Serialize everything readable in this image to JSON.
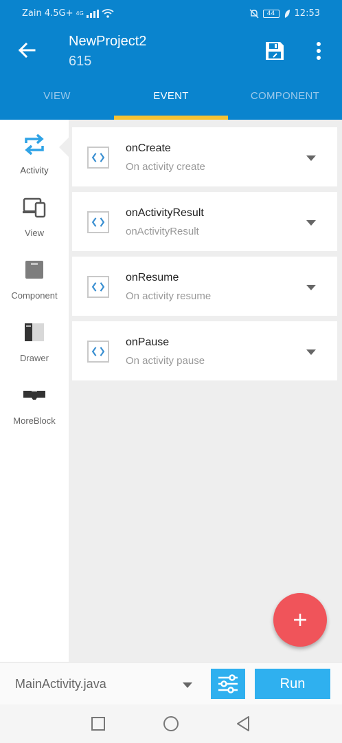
{
  "status_bar": {
    "carrier": "Zain 4.5G+",
    "network_badge": "4G",
    "battery": "44",
    "time": "12:53"
  },
  "app_bar": {
    "title": "NewProject2",
    "subtitle": "615",
    "back_icon": "arrow-back-icon",
    "save_icon": "save-icon",
    "more_icon": "more-vert-icon",
    "background_color": "#0a84ce",
    "indicator_color": "#f5c233"
  },
  "tabs": [
    {
      "label": "VIEW",
      "active": false
    },
    {
      "label": "EVENT",
      "active": true
    },
    {
      "label": "COMPONENT",
      "active": false
    }
  ],
  "sidebar": {
    "items": [
      {
        "label": "Activity",
        "icon": "refresh-cycle-icon",
        "active": true
      },
      {
        "label": "View",
        "icon": "devices-icon",
        "active": false
      },
      {
        "label": "Component",
        "icon": "component-box-icon",
        "active": false
      },
      {
        "label": "Drawer",
        "icon": "drawer-icon",
        "active": false
      },
      {
        "label": "MoreBlock",
        "icon": "moreblock-icon",
        "active": false
      }
    ]
  },
  "events": [
    {
      "name": "onCreate",
      "description": "On activity create"
    },
    {
      "name": "onActivityResult",
      "description": "onActivityResult"
    },
    {
      "name": "onResume",
      "description": "On activity resume"
    },
    {
      "name": "onPause",
      "description": "On activity pause"
    }
  ],
  "fab": {
    "icon": "add-icon",
    "color": "#f0545a"
  },
  "bottom_bar": {
    "file_name": "MainActivity.java",
    "settings_icon": "sliders-icon",
    "run_label": "Run",
    "button_color": "#2fb0ef"
  },
  "nav_bar": {
    "recents_icon": "square-icon",
    "home_icon": "circle-icon",
    "back_icon": "triangle-back-icon"
  }
}
